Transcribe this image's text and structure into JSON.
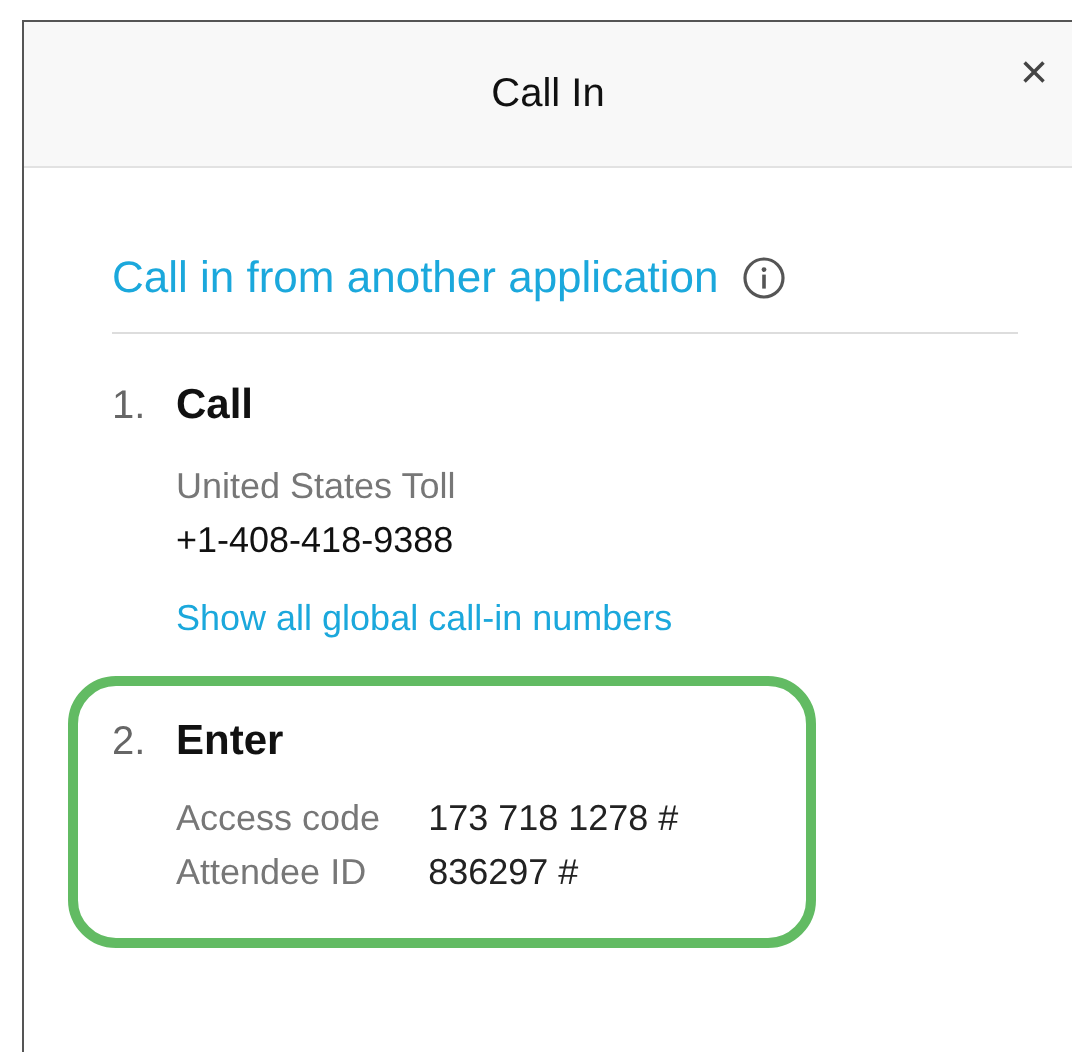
{
  "window": {
    "title": "Call In",
    "close": "×"
  },
  "heading": {
    "text": "Call in from another application"
  },
  "steps": [
    {
      "number": "1.",
      "title": "Call",
      "kind": "number",
      "highlighted": false,
      "label": "United States Toll",
      "value": "+1-408-418-9388",
      "link": "Show all global call-in numbers"
    },
    {
      "number": "2.",
      "title": "Enter",
      "kind": "fields",
      "highlighted": true,
      "fields": [
        {
          "label": "Access code",
          "value": "173 718 1278 #"
        },
        {
          "label": "Attendee ID",
          "value": "836297 #"
        }
      ]
    }
  ]
}
